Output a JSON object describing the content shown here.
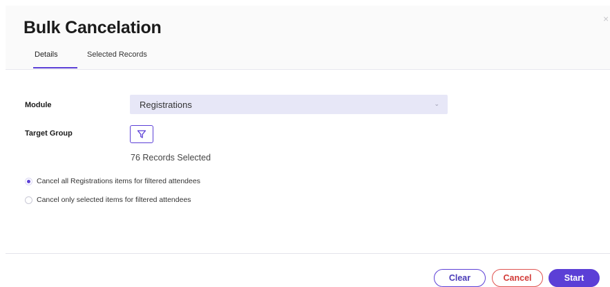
{
  "dialog": {
    "title": "Bulk Cancelation",
    "close_glyph": "×"
  },
  "tabs": [
    {
      "label": "Details",
      "active": true
    },
    {
      "label": "Selected Records",
      "active": false
    }
  ],
  "form": {
    "module": {
      "label": "Module",
      "value": "Registrations"
    },
    "target_group": {
      "label": "Target Group",
      "filter_icon": "filter-icon",
      "records_selected": "76 Records Selected"
    },
    "options": [
      {
        "label": "Cancel all Registrations items for filtered attendees",
        "checked": true
      },
      {
        "label": "Cancel only selected items for filtered attendees",
        "checked": false
      }
    ]
  },
  "footer": {
    "clear_label": "Clear",
    "cancel_label": "Cancel",
    "start_label": "Start"
  },
  "colors": {
    "accent": "#5b3fd6",
    "danger": "#e0524f",
    "select_bg": "#e7e7f7"
  }
}
